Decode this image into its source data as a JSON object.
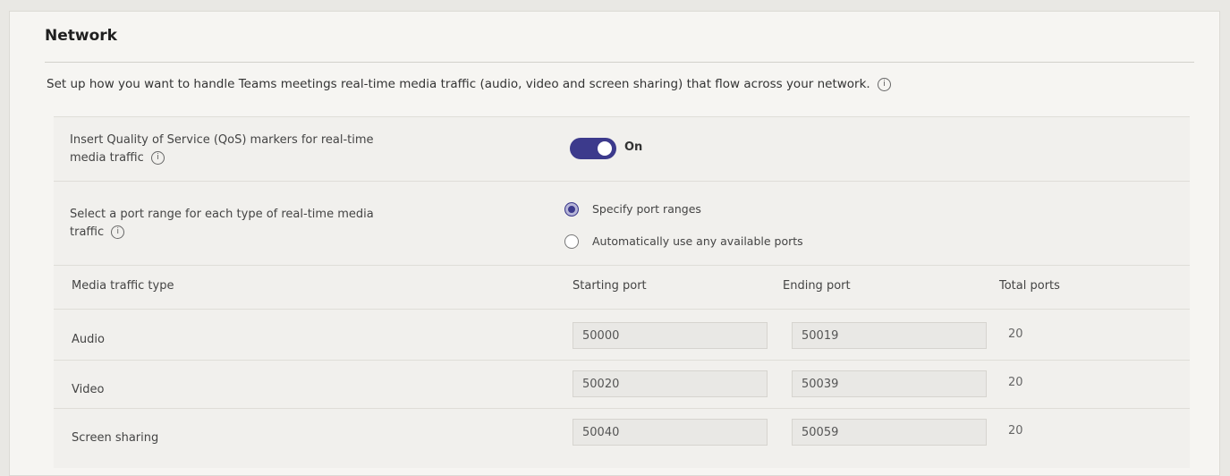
{
  "header": {
    "title": "Network",
    "description": "Set up how you want to handle Teams meetings real-time media traffic (audio, video and screen sharing) that flow across your network.",
    "info_icon": "info-icon"
  },
  "qos": {
    "label_line1": "Insert Quality of Service (QoS) markers for real-time",
    "label_line2": "media traffic",
    "toggle_state": "On"
  },
  "port_range": {
    "label_line1": "Select a port range for each type of real-time media",
    "label_line2": "traffic",
    "options": [
      {
        "label": "Specify port ranges",
        "selected": true
      },
      {
        "label": "Automatically use any available ports",
        "selected": false
      }
    ]
  },
  "table": {
    "headers": [
      "Media traffic type",
      "Starting port",
      "Ending port",
      "Total ports"
    ],
    "rows": [
      {
        "type": "Audio",
        "start": "50000",
        "end": "50019",
        "total": "20"
      },
      {
        "type": "Video",
        "start": "50020",
        "end": "50039",
        "total": "20"
      },
      {
        "type": "Screen sharing",
        "start": "50040",
        "end": "50059",
        "total": "20"
      }
    ]
  },
  "colors": {
    "accent": "#3c3a8c",
    "background": "#f6f5f2"
  }
}
